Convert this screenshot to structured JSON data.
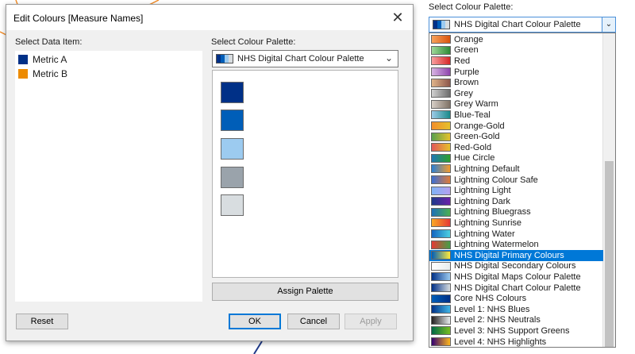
{
  "dialog": {
    "title": "Edit Colours [Measure Names]",
    "select_data_item_label": "Select Data Item:",
    "select_palette_label": "Select Colour Palette:",
    "data_items": [
      {
        "label": "Metric A",
        "color": "#003087"
      },
      {
        "label": "Metric B",
        "color": "#ed8b00"
      }
    ],
    "palette_value": "NHS Digital Chart Colour Palette",
    "palette_swatches": [
      "#003087",
      "#005eb8",
      "#9ccbf0",
      "#9aa3ab",
      "#d8dde0"
    ],
    "buttons": {
      "assign": "Assign Palette",
      "reset": "Reset",
      "ok": "OK",
      "cancel": "Cancel",
      "apply": "Apply"
    }
  },
  "dropdown": {
    "label": "Select Colour Palette:",
    "selected": "NHS Digital Chart Colour Palette",
    "items": [
      {
        "label": "Orange",
        "c1": "#f7a35c",
        "c2": "#d9540e"
      },
      {
        "label": "Green",
        "c1": "#9fd99a",
        "c2": "#2e8b36"
      },
      {
        "label": "Red",
        "c1": "#f8a0a0",
        "c2": "#d62728"
      },
      {
        "label": "Purple",
        "c1": "#d7b5e3",
        "c2": "#8e44ad"
      },
      {
        "label": "Brown",
        "c1": "#e0b48a",
        "c2": "#8c564b"
      },
      {
        "label": "Grey",
        "c1": "#d0d0d0",
        "c2": "#6b6b6b"
      },
      {
        "label": "Grey Warm",
        "c1": "#d7cfc7",
        "c2": "#7f7165"
      },
      {
        "label": "Blue-Teal",
        "c1": "#9ecbe8",
        "c2": "#1a8a8a"
      },
      {
        "label": "Orange-Gold",
        "c1": "#f28e2b",
        "c2": "#e5c12c"
      },
      {
        "label": "Green-Gold",
        "c1": "#59a14f",
        "c2": "#e5c12c"
      },
      {
        "label": "Red-Gold",
        "c1": "#e15759",
        "c2": "#e5c12c"
      },
      {
        "label": "Hue Circle",
        "c1": "#1f77b4",
        "c2": "#2ca02c"
      },
      {
        "label": "Lightning Default",
        "c1": "#2a7fd4",
        "c2": "#f59b2c"
      },
      {
        "label": "Lightning Colour Safe",
        "c1": "#3a6fd4",
        "c2": "#e07b39"
      },
      {
        "label": "Lightning Light",
        "c1": "#7fb3f5",
        "c2": "#b5a0f0"
      },
      {
        "label": "Lightning Dark",
        "c1": "#1e3a8a",
        "c2": "#6b21a8"
      },
      {
        "label": "Lightning Bluegrass",
        "c1": "#1e6fb8",
        "c2": "#4caf50"
      },
      {
        "label": "Lightning Sunrise",
        "c1": "#f9a825",
        "c2": "#e53935"
      },
      {
        "label": "Lightning Water",
        "c1": "#1565c0",
        "c2": "#4dd0e1"
      },
      {
        "label": "Lightning Watermelon",
        "c1": "#e53935",
        "c2": "#43a047"
      },
      {
        "label": "NHS Digital Primary Colours",
        "c1": "#005eb8",
        "c2": "#ffeb3b"
      },
      {
        "label": "NHS Digital Secondary Colours",
        "c1": "#ffffff",
        "c2": "#e8edee"
      },
      {
        "label": "NHS Digital Maps Colour Palette",
        "c1": "#003087",
        "c2": "#9ccbf0"
      },
      {
        "label": "NHS Digital Chart Colour Palette",
        "c1": "#003087",
        "c2": "#d8dde0"
      },
      {
        "label": "Core NHS Colours",
        "c1": "#005eb8",
        "c2": "#003087"
      },
      {
        "label": "Level 1: NHS Blues",
        "c1": "#003087",
        "c2": "#41b6e6"
      },
      {
        "label": "Level 2: NHS Neutrals",
        "c1": "#231f20",
        "c2": "#e8edee"
      },
      {
        "label": "Level 3: NHS Support Greens",
        "c1": "#006747",
        "c2": "#78be20"
      },
      {
        "label": "Level 4: NHS Highlights",
        "c1": "#330072",
        "c2": "#ffb81c"
      }
    ],
    "highlighted_index": 20
  }
}
